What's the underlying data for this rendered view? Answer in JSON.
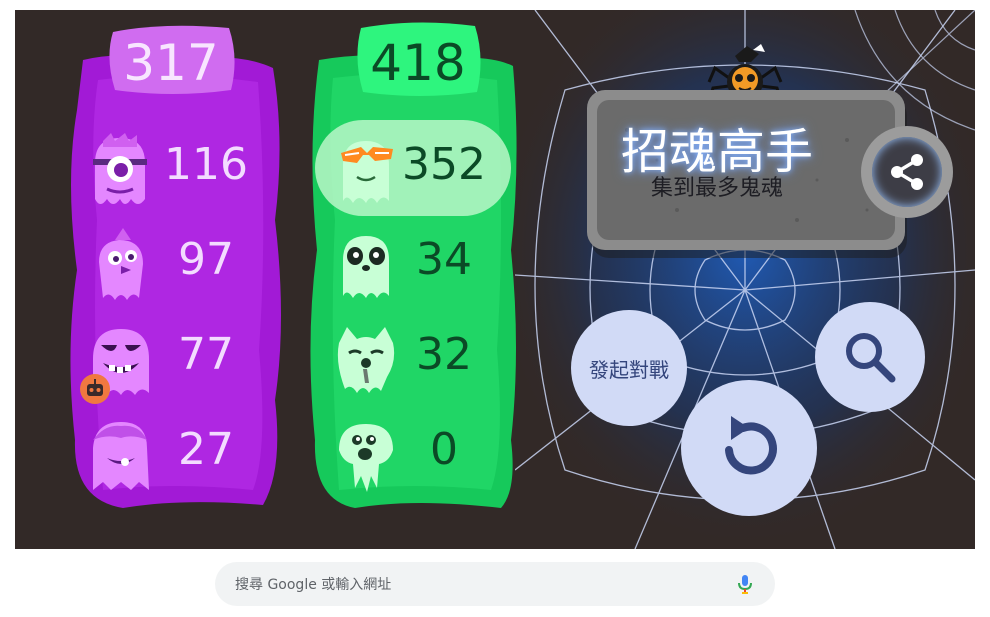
{
  "purple_team": {
    "total": "317",
    "members": [
      {
        "ghost": "one-eyed-ghost-icon",
        "score": "116"
      },
      {
        "ghost": "bird-ghost-icon",
        "score": "97"
      },
      {
        "ghost": "grinning-ghost-icon",
        "score": "77",
        "badge": "robot-icon"
      },
      {
        "ghost": "shaggy-ghost-icon",
        "score": "27"
      }
    ],
    "color": "#a020d8"
  },
  "green_team": {
    "total": "418",
    "members": [
      {
        "ghost": "sunglasses-ghost-icon",
        "score": "352",
        "highlighted": true
      },
      {
        "ghost": "panda-ghost-icon",
        "score": "34"
      },
      {
        "ghost": "cat-ghost-icon",
        "score": "32"
      },
      {
        "ghost": "jellyfish-ghost-icon",
        "score": "0"
      }
    ],
    "color": "#22d868"
  },
  "banner": {
    "title": "招魂高手",
    "subtitle": "集到最多鬼魂"
  },
  "buttons": {
    "challenge_label": "發起對戰",
    "share_icon": "share-icon",
    "search_icon": "search-icon",
    "replay_icon": "replay-icon"
  },
  "searchbar": {
    "placeholder": "搜尋 Google 或輸入網址",
    "mic_icon": "microphone-icon"
  },
  "colors": {
    "background": "#322927",
    "purple": "#a020d8",
    "green": "#22d868",
    "button": "#d1daf6",
    "button_icon": "#34457c"
  }
}
